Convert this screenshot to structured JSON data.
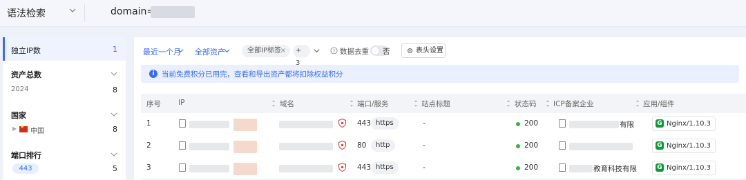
{
  "search": {
    "mode_label": "语法检索",
    "query_prefix": "domain='"
  },
  "sidebar": {
    "sections": [
      {
        "title": "独立IP数",
        "count": "1"
      },
      {
        "title": "资产总数",
        "items": [
          {
            "label": "2024",
            "count": "8"
          }
        ]
      },
      {
        "title": "国家",
        "items": [
          {
            "label": "中国",
            "count": "8"
          }
        ]
      },
      {
        "title": "端口排行",
        "items": [
          {
            "label": "443",
            "count": "5"
          }
        ]
      }
    ]
  },
  "filters": {
    "time_range": "最近一个月",
    "asset_scope": "全部资产",
    "ip_tag_chip": "全部IP标签",
    "more_chip": "+ 3",
    "dedupe_label": "数据去重",
    "dedupe_state": "否",
    "header_settings": "表头设置"
  },
  "notice": {
    "text": "当前免费积分已用完，查看和导出资产都将扣除权益积分"
  },
  "table": {
    "columns": [
      "序号",
      "IP",
      "域名",
      "端口/服务",
      "站点标题",
      "状态码",
      "ICP备案企业",
      "应用/组件"
    ],
    "rows": [
      {
        "index": "1",
        "port": "443",
        "service": "https",
        "title": "-",
        "status": "200",
        "icp": "有限",
        "app": "Nginx/1.10.3"
      },
      {
        "index": "2",
        "port": "80",
        "service": "http",
        "title": "-",
        "status": "200",
        "icp": "",
        "app": "Nginx/1.10.3"
      },
      {
        "index": "3",
        "port": "443",
        "service": "https",
        "title": "-",
        "status": "200",
        "icp": "教育科技有限",
        "app": "Nginx/1.10.3"
      }
    ]
  },
  "colors": {
    "accent": "#3b6cf5",
    "status_ok": "#37b24d",
    "nginx_green": "#0b9b3a",
    "shield_red": "#e0393e"
  }
}
